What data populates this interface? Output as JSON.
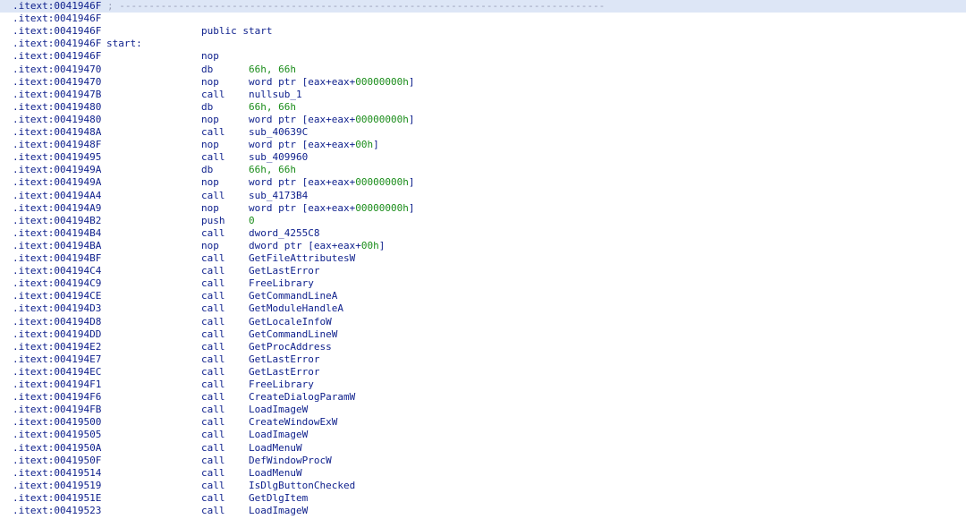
{
  "segment": ".itext",
  "separator": "; ----------------------------------------------------------------------------------",
  "lines": [
    {
      "addr": "0041946F",
      "kind": "separator"
    },
    {
      "addr": "0041946F",
      "kind": "blank"
    },
    {
      "addr": "0041946F",
      "kind": "directive",
      "text": "public start"
    },
    {
      "addr": "0041946F",
      "kind": "label",
      "text": "start:"
    },
    {
      "addr": "0041946F",
      "mnem": "nop",
      "ops": []
    },
    {
      "addr": "00419470",
      "mnem": "db",
      "ops": [
        {
          "t": "66h, 66h",
          "num": true
        }
      ]
    },
    {
      "addr": "00419470",
      "mnem": "nop",
      "ops": [
        {
          "t": "word ptr [eax+eax+"
        },
        {
          "t": "00000000h",
          "num": true
        },
        {
          "t": "]"
        }
      ]
    },
    {
      "addr": "0041947B",
      "mnem": "call",
      "ops": [
        {
          "t": "nullsub_1"
        }
      ]
    },
    {
      "addr": "00419480",
      "mnem": "db",
      "ops": [
        {
          "t": "66h, 66h",
          "num": true
        }
      ]
    },
    {
      "addr": "00419480",
      "mnem": "nop",
      "ops": [
        {
          "t": "word ptr [eax+eax+"
        },
        {
          "t": "00000000h",
          "num": true
        },
        {
          "t": "]"
        }
      ]
    },
    {
      "addr": "0041948A",
      "mnem": "call",
      "ops": [
        {
          "t": "sub_40639C"
        }
      ]
    },
    {
      "addr": "0041948F",
      "mnem": "nop",
      "ops": [
        {
          "t": "word ptr [eax+eax+"
        },
        {
          "t": "00h",
          "num": true
        },
        {
          "t": "]"
        }
      ]
    },
    {
      "addr": "00419495",
      "mnem": "call",
      "ops": [
        {
          "t": "sub_409960"
        }
      ]
    },
    {
      "addr": "0041949A",
      "mnem": "db",
      "ops": [
        {
          "t": "66h, 66h",
          "num": true
        }
      ]
    },
    {
      "addr": "0041949A",
      "mnem": "nop",
      "ops": [
        {
          "t": "word ptr [eax+eax+"
        },
        {
          "t": "00000000h",
          "num": true
        },
        {
          "t": "]"
        }
      ]
    },
    {
      "addr": "004194A4",
      "mnem": "call",
      "ops": [
        {
          "t": "sub_4173B4"
        }
      ]
    },
    {
      "addr": "004194A9",
      "mnem": "nop",
      "ops": [
        {
          "t": "word ptr [eax+eax+"
        },
        {
          "t": "00000000h",
          "num": true
        },
        {
          "t": "]"
        }
      ]
    },
    {
      "addr": "004194B2",
      "mnem": "push",
      "ops": [
        {
          "t": "0",
          "num": true
        }
      ]
    },
    {
      "addr": "004194B4",
      "mnem": "call",
      "ops": [
        {
          "t": "dword_4255C8"
        }
      ]
    },
    {
      "addr": "004194BA",
      "mnem": "nop",
      "ops": [
        {
          "t": "dword ptr [eax+eax+"
        },
        {
          "t": "00h",
          "num": true
        },
        {
          "t": "]"
        }
      ]
    },
    {
      "addr": "004194BF",
      "mnem": "call",
      "ops": [
        {
          "t": "GetFileAttributesW"
        }
      ]
    },
    {
      "addr": "004194C4",
      "mnem": "call",
      "ops": [
        {
          "t": "GetLastError"
        }
      ]
    },
    {
      "addr": "004194C9",
      "mnem": "call",
      "ops": [
        {
          "t": "FreeLibrary"
        }
      ]
    },
    {
      "addr": "004194CE",
      "mnem": "call",
      "ops": [
        {
          "t": "GetCommandLineA"
        }
      ]
    },
    {
      "addr": "004194D3",
      "mnem": "call",
      "ops": [
        {
          "t": "GetModuleHandleA"
        }
      ]
    },
    {
      "addr": "004194D8",
      "mnem": "call",
      "ops": [
        {
          "t": "GetLocaleInfoW"
        }
      ]
    },
    {
      "addr": "004194DD",
      "mnem": "call",
      "ops": [
        {
          "t": "GetCommandLineW"
        }
      ]
    },
    {
      "addr": "004194E2",
      "mnem": "call",
      "ops": [
        {
          "t": "GetProcAddress"
        }
      ]
    },
    {
      "addr": "004194E7",
      "mnem": "call",
      "ops": [
        {
          "t": "GetLastError"
        }
      ]
    },
    {
      "addr": "004194EC",
      "mnem": "call",
      "ops": [
        {
          "t": "GetLastError"
        }
      ]
    },
    {
      "addr": "004194F1",
      "mnem": "call",
      "ops": [
        {
          "t": "FreeLibrary"
        }
      ]
    },
    {
      "addr": "004194F6",
      "mnem": "call",
      "ops": [
        {
          "t": "CreateDialogParamW"
        }
      ]
    },
    {
      "addr": "004194FB",
      "mnem": "call",
      "ops": [
        {
          "t": "LoadImageW"
        }
      ]
    },
    {
      "addr": "00419500",
      "mnem": "call",
      "ops": [
        {
          "t": "CreateWindowExW"
        }
      ]
    },
    {
      "addr": "00419505",
      "mnem": "call",
      "ops": [
        {
          "t": "LoadImageW"
        }
      ]
    },
    {
      "addr": "0041950A",
      "mnem": "call",
      "ops": [
        {
          "t": "LoadMenuW"
        }
      ]
    },
    {
      "addr": "0041950F",
      "mnem": "call",
      "ops": [
        {
          "t": "DefWindowProcW"
        }
      ]
    },
    {
      "addr": "00419514",
      "mnem": "call",
      "ops": [
        {
          "t": "LoadMenuW"
        }
      ]
    },
    {
      "addr": "00419519",
      "mnem": "call",
      "ops": [
        {
          "t": "IsDlgButtonChecked"
        }
      ]
    },
    {
      "addr": "0041951E",
      "mnem": "call",
      "ops": [
        {
          "t": "GetDlgItem"
        }
      ]
    },
    {
      "addr": "00419523",
      "mnem": "call",
      "ops": [
        {
          "t": "LoadImageW"
        }
      ]
    }
  ]
}
